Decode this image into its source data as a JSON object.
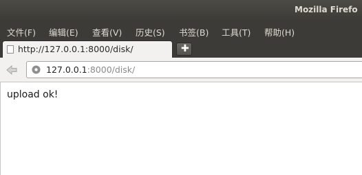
{
  "window": {
    "title": "Mozilla Firefo"
  },
  "menubar": {
    "items": [
      {
        "label": "文件(F)"
      },
      {
        "label": "编辑(E)"
      },
      {
        "label": "查看(V)"
      },
      {
        "label": "历史(S)"
      },
      {
        "label": "书签(B)"
      },
      {
        "label": "工具(T)"
      },
      {
        "label": "帮助(H)"
      }
    ]
  },
  "tabs": [
    {
      "title": "http://127.0.0.1:8000/disk/",
      "active": true,
      "icon": "blank-page-icon"
    }
  ],
  "new_tab": {
    "icon": "plus-icon"
  },
  "navbar": {
    "back_icon": "back-arrow-icon",
    "site_icon": "globe-icon",
    "url_host": "127.0.0.1",
    "url_path": ":8000/disk/"
  },
  "page": {
    "message": "upload ok!"
  },
  "colors": {
    "chrome_dark": "#3c3b37",
    "title_text": "#dfdbd2",
    "toolbar_bg": "#f2f1f0",
    "url_path_gray": "#8a8a8a"
  }
}
